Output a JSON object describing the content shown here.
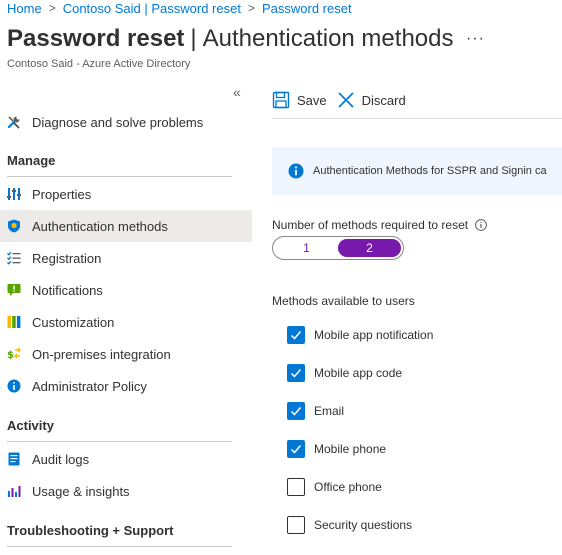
{
  "breadcrumb": [
    "Home",
    "Contoso Said | Password reset",
    "Password reset"
  ],
  "header": {
    "title_bold": "Password reset",
    "title_sep": "|",
    "title_rest": "Authentication methods",
    "more": "···",
    "subtitle": "Contoso Said - Azure Active Directory",
    "collapse": "«"
  },
  "sidebar": {
    "top_item": {
      "label": "Diagnose and solve problems",
      "icon": "wrench-icon"
    },
    "sections": [
      {
        "header": "Manage",
        "items": [
          {
            "label": "Properties",
            "icon": "properties-icon",
            "selected": false
          },
          {
            "label": "Authentication methods",
            "icon": "shield-icon",
            "selected": true
          },
          {
            "label": "Registration",
            "icon": "checklist-icon",
            "selected": false
          },
          {
            "label": "Notifications",
            "icon": "notification-icon",
            "selected": false
          },
          {
            "label": "Customization",
            "icon": "customization-icon",
            "selected": false
          },
          {
            "label": "On-premises integration",
            "icon": "sync-icon",
            "selected": false
          },
          {
            "label": "Administrator Policy",
            "icon": "info-icon",
            "selected": false
          }
        ]
      },
      {
        "header": "Activity",
        "items": [
          {
            "label": "Audit logs",
            "icon": "audit-log-icon",
            "selected": false
          },
          {
            "label": "Usage & insights",
            "icon": "chart-icon",
            "selected": false
          }
        ]
      },
      {
        "header": "Troubleshooting + Support",
        "items": []
      }
    ]
  },
  "toolbar": {
    "save_label": "Save",
    "discard_label": "Discard"
  },
  "info_banner": {
    "text": "Authentication Methods for SSPR and Signin ca"
  },
  "methods_required": {
    "label": "Number of methods required to reset",
    "options": [
      "1",
      "2"
    ],
    "selected": "2"
  },
  "methods_available": {
    "label": "Methods available to users",
    "items": [
      {
        "label": "Mobile app notification",
        "checked": true
      },
      {
        "label": "Mobile app code",
        "checked": true
      },
      {
        "label": "Email",
        "checked": true
      },
      {
        "label": "Mobile phone",
        "checked": true
      },
      {
        "label": "Office phone",
        "checked": false
      },
      {
        "label": "Security questions",
        "checked": false
      }
    ]
  },
  "colors": {
    "link": "#0078d4",
    "accent_purple": "#7719aa",
    "checkbox_blue": "#0078d4",
    "selected_nav_bg": "#edebe9",
    "banner_bg": "#f0f6ff"
  }
}
